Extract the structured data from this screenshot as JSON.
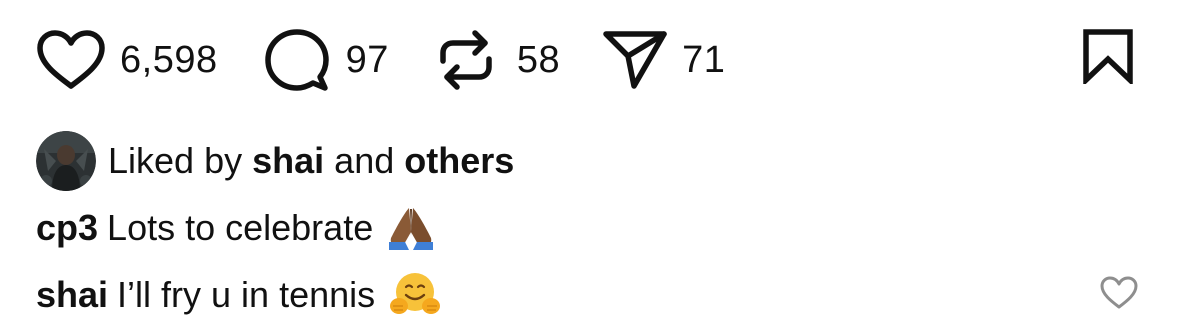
{
  "actions": {
    "likes": "6,598",
    "comments": "97",
    "reposts": "58",
    "shares": "71"
  },
  "liked_by": {
    "prefix": "Liked by",
    "user": "shai",
    "connector": "and",
    "others": "others"
  },
  "comments": [
    {
      "author": "cp3",
      "text": "Lots to celebrate",
      "emoji": "folded-hands"
    },
    {
      "author": "shai",
      "text": "I’ll fry u in tennis",
      "emoji": "hugging-face"
    }
  ],
  "icons": {
    "like": "heart-outline-icon",
    "comment": "speech-bubble-icon",
    "repost": "repost-arrows-icon",
    "share": "paper-plane-icon",
    "bookmark": "bookmark-outline-icon",
    "comment_like": "small-heart-outline-icon"
  },
  "colors": {
    "text": "#111111",
    "icon_stroke": "#111111",
    "comment_like_stroke": "#8e8e8e"
  }
}
